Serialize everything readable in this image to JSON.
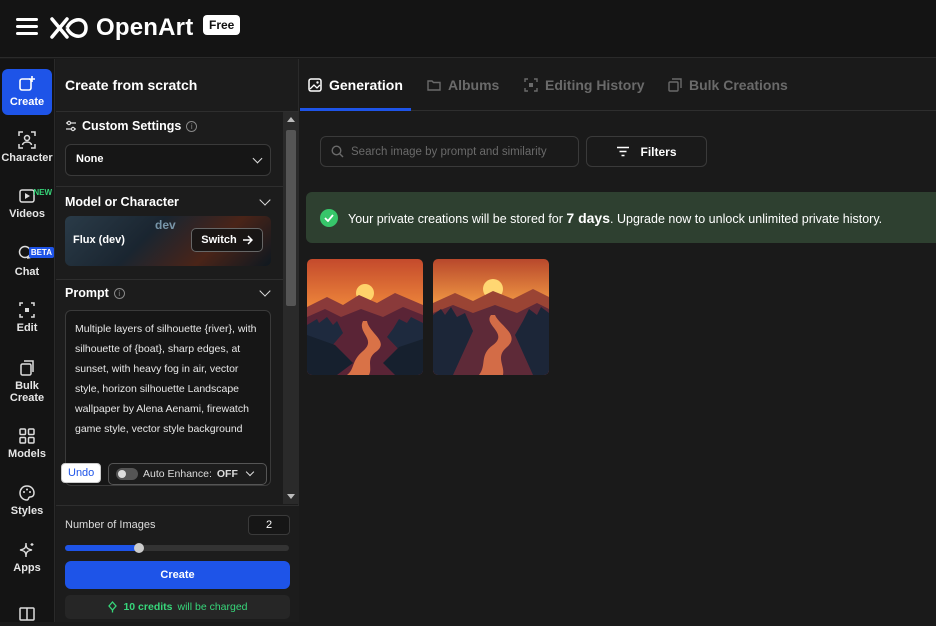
{
  "app": {
    "brand": "OpenArt",
    "plan_badge": "Free"
  },
  "nav": {
    "items": [
      {
        "label": "Create"
      },
      {
        "label": "Character"
      },
      {
        "label": "Videos",
        "tag": "NEW"
      },
      {
        "label": "Chat",
        "tag": "BETA"
      },
      {
        "label": "Edit"
      },
      {
        "label": "Bulk Create"
      },
      {
        "label": "Models"
      },
      {
        "label": "Styles"
      },
      {
        "label": "Apps"
      }
    ]
  },
  "panel": {
    "title": "Create from scratch",
    "custom_settings": {
      "label": "Custom Settings",
      "value": "None"
    },
    "model": {
      "label": "Model or Character",
      "name": "Flux (dev)",
      "bg_text": "dev",
      "switch_label": "Switch"
    },
    "prompt": {
      "label": "Prompt",
      "text": "Multiple layers of silhouette {river}, with silhouette of {boat}, sharp edges, at sunset, with heavy fog in air, vector style, horizon silhouette Landscape wallpaper by Alena Aenami, firewatch game style, vector style background",
      "undo_label": "Undo",
      "enhance_label": "Auto Enhance:",
      "enhance_state": "OFF"
    },
    "num_images": {
      "label": "Number of Images",
      "value": "2",
      "slider_fraction": 0.33
    },
    "create_label": "Create",
    "credits": {
      "amount": "10 credits",
      "suffix": "will be charged"
    }
  },
  "main": {
    "tabs": [
      {
        "label": "Generation",
        "active": true
      },
      {
        "label": "Albums",
        "active": false
      },
      {
        "label": "Editing History",
        "active": false
      },
      {
        "label": "Bulk Creations",
        "active": false
      }
    ],
    "search_placeholder": "Search image by prompt and similarity",
    "filters_label": "Filters",
    "banner": {
      "prefix": "Your private creations will be stored for",
      "highlight": "7 days",
      "suffix": ". Upgrade now to unlock unlimited private history."
    }
  },
  "colors": {
    "accent": "#1e54e8",
    "success": "#37d67a",
    "banner_bg": "#2e4030"
  }
}
